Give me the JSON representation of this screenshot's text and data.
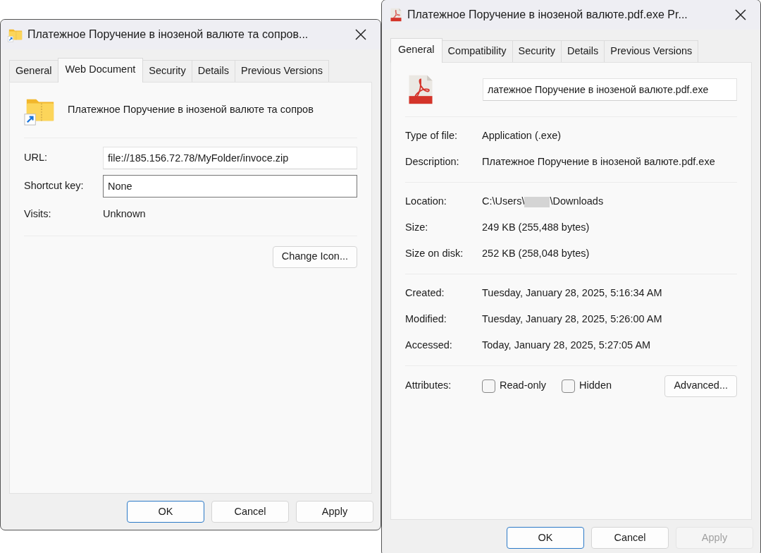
{
  "left_dialog": {
    "title": "Платежное Поручение в інозеной валюте та сопров...",
    "tabs": [
      {
        "label": "General",
        "selected": false
      },
      {
        "label": "Web Document",
        "selected": true
      },
      {
        "label": "Security",
        "selected": false
      },
      {
        "label": "Details",
        "selected": false
      },
      {
        "label": "Previous Versions",
        "selected": false
      }
    ],
    "file_name": "Платежное Поручение в інозеной валюте та сопров",
    "fields": [
      {
        "label": "URL:",
        "value": "file://185.156.72.78/MyFolder/invoce.zip",
        "kind": "input",
        "focused": false
      },
      {
        "label": "Shortcut key:",
        "value": "None",
        "kind": "input",
        "focused": true
      },
      {
        "label": "Visits:",
        "value": "Unknown",
        "kind": "text"
      }
    ],
    "change_icon_button": "Change Icon...",
    "buttons": [
      {
        "label": "OK",
        "default": true,
        "disabled": false
      },
      {
        "label": "Cancel",
        "default": false,
        "disabled": false
      },
      {
        "label": "Apply",
        "default": false,
        "disabled": false
      }
    ]
  },
  "right_dialog": {
    "title": "Платежное Поручение в інозеной валюте.pdf.exe Pr...",
    "tabs": [
      {
        "label": "General",
        "selected": true
      },
      {
        "label": "Compatibility",
        "selected": false
      },
      {
        "label": "Security",
        "selected": false
      },
      {
        "label": "Details",
        "selected": false
      },
      {
        "label": "Previous Versions",
        "selected": false
      }
    ],
    "file_name_field": "латежное Поручение в інозеной валюте.pdf.exe",
    "groups": [
      [
        {
          "label": "Type of file:",
          "value": "Application (.exe)"
        },
        {
          "label": "Description:",
          "value": "Платежное Поручение в інозеной валюте.pdf.exe"
        }
      ],
      [
        {
          "label": "Location:",
          "value_parts": [
            "C:\\Users\\",
            "\\Downloads"
          ]
        },
        {
          "label": "Size:",
          "value": "249 KB (255,488 bytes)"
        },
        {
          "label": "Size on disk:",
          "value": "252 KB (258,048 bytes)"
        }
      ],
      [
        {
          "label": "Created:",
          "value": "Tuesday, January 28, 2025, 5:16:34 AM"
        },
        {
          "label": "Modified:",
          "value": "Tuesday, January 28, 2025, 5:26:00 AM"
        },
        {
          "label": "Accessed:",
          "value": "Today, January 28, 2025, 5:27:05 AM"
        }
      ]
    ],
    "attributes_label": "Attributes:",
    "attributes": [
      {
        "label": "Read-only",
        "checked": false
      },
      {
        "label": "Hidden",
        "checked": false
      }
    ],
    "advanced_button": "Advanced...",
    "buttons": [
      {
        "label": "OK",
        "default": true,
        "disabled": false
      },
      {
        "label": "Cancel",
        "default": false,
        "disabled": false
      },
      {
        "label": "Apply",
        "default": false,
        "disabled": true
      }
    ]
  }
}
